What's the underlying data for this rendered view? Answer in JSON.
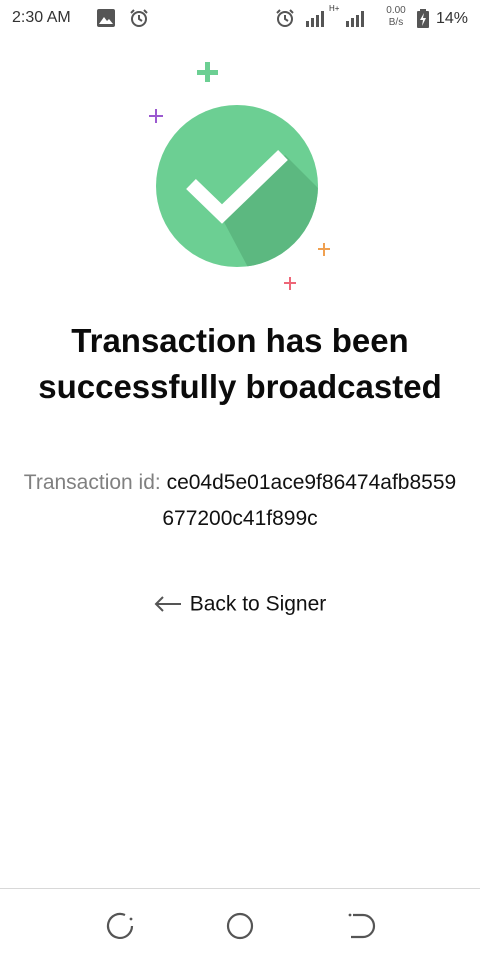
{
  "status_bar": {
    "time": "2:30 AM",
    "network_type": "H+",
    "speed_value": "0.00",
    "speed_unit": "B/s",
    "battery": "14%"
  },
  "success": {
    "title_line1": "Transaction has been",
    "title_line2": "successfully broadcasted",
    "tx_label": "Transaction id:",
    "tx_id": "ce04d5e01ace9f86474afb8559677200c41f899c",
    "accent_color": "#6ccf93",
    "shadow_color": "#5cb880"
  },
  "actions": {
    "back_label": "Back to Signer"
  },
  "icons": {
    "status": [
      "image-icon",
      "alarm-icon",
      "alarm-icon",
      "signal-icon",
      "signal-icon",
      "battery-charging-icon"
    ],
    "hero": [
      "checkmark-icon",
      "sparkle-icon"
    ],
    "nav": [
      "recent-apps-icon",
      "home-icon",
      "back-icon"
    ]
  }
}
